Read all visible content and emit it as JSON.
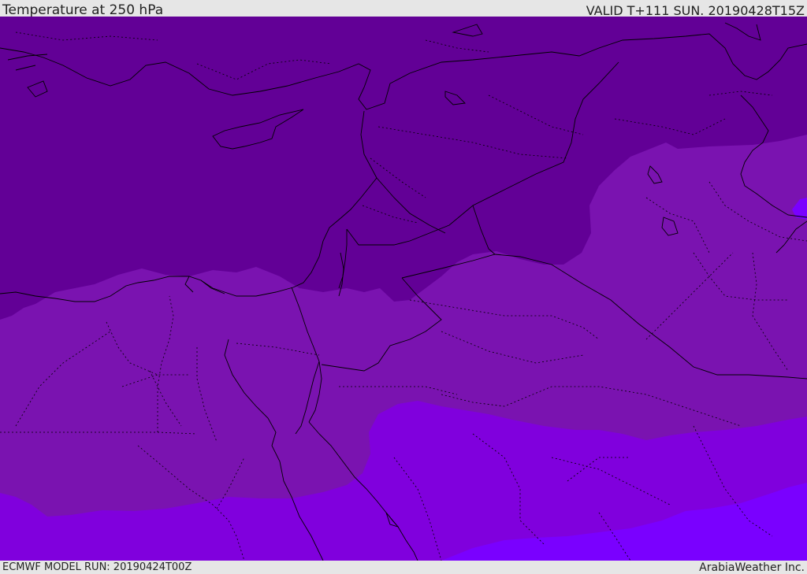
{
  "header": {
    "title": "Temperature at 250 hPa",
    "valid": "VALID T+111 SUN. 20190428T15Z"
  },
  "footer": {
    "model_run": "ECMWF MODEL RUN: 20190424T00Z",
    "credit": "ArabiaWeather Inc."
  },
  "map": {
    "field": "temperature",
    "level": "250 hPa",
    "colors": {
      "band_coldest": "#620096",
      "band_cold": "#7a13b0",
      "band_mid": "#8000dd",
      "band_warm": "#7a00ff",
      "coastline": "#000000",
      "borders": "#000000"
    }
  }
}
